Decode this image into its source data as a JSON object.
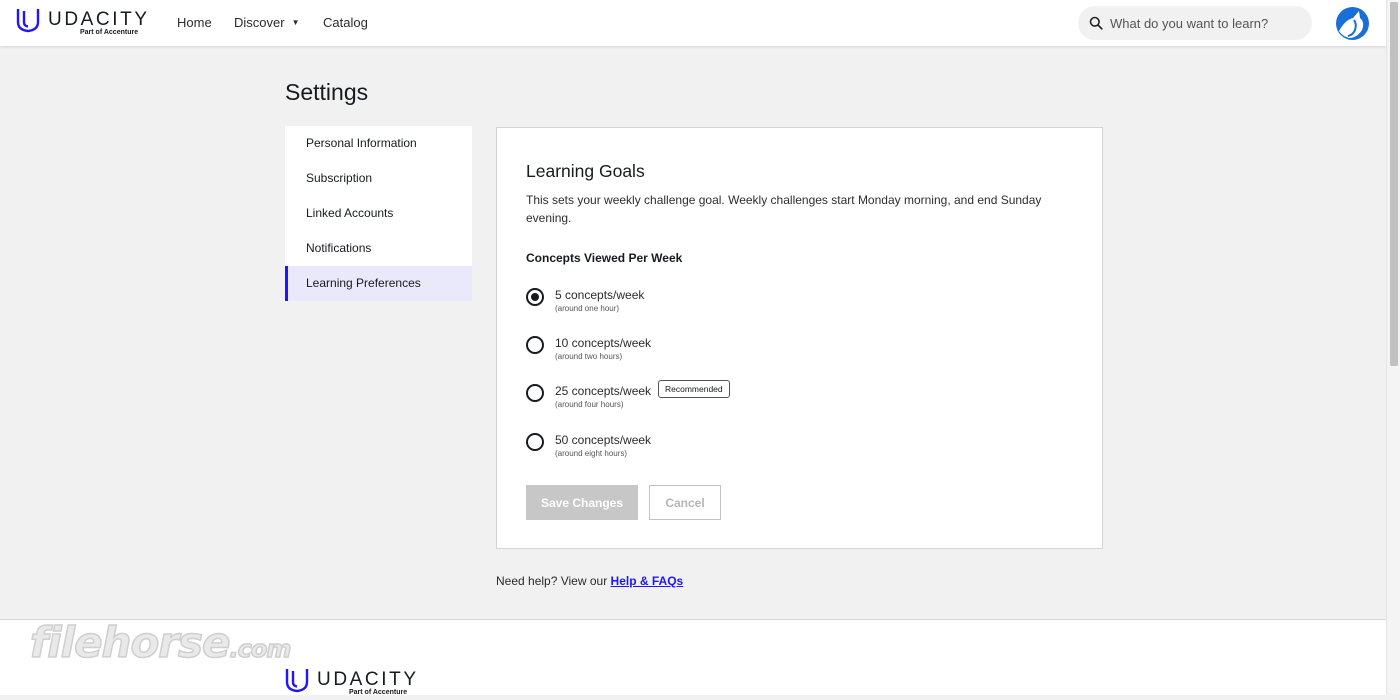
{
  "header": {
    "brand_name": "UDACITY",
    "brand_subtitle": "Part of Accenture",
    "nav": [
      {
        "label": "Home"
      },
      {
        "label": "Discover",
        "has_dropdown": true
      },
      {
        "label": "Catalog"
      }
    ],
    "search": {
      "placeholder": "What do you want to learn?",
      "value": ""
    }
  },
  "page": {
    "title": "Settings"
  },
  "sidebar": {
    "items": [
      {
        "label": "Personal Information",
        "active": false
      },
      {
        "label": "Subscription",
        "active": false
      },
      {
        "label": "Linked Accounts",
        "active": false
      },
      {
        "label": "Notifications",
        "active": false
      },
      {
        "label": "Learning Preferences",
        "active": true
      }
    ]
  },
  "card": {
    "title": "Learning Goals",
    "description": "This sets your weekly challenge goal. Weekly challenges start Monday morning, and end Sunday evening.",
    "group_label": "Concepts Viewed Per Week",
    "options": [
      {
        "label": "5 concepts/week",
        "sub": "(around one hour)",
        "checked": true
      },
      {
        "label": "10 concepts/week",
        "sub": "(around two hours)",
        "checked": false
      },
      {
        "label": "25 concepts/week",
        "sub": "(around four hours)",
        "checked": false,
        "badge": "Recommended"
      },
      {
        "label": "50 concepts/week",
        "sub": "(around eight hours)",
        "checked": false
      }
    ],
    "save_label": "Save Changes",
    "cancel_label": "Cancel"
  },
  "help": {
    "prefix": "Need help? View our",
    "link_label": "Help & FAQs"
  },
  "footer": {
    "brand_name": "UDACITY",
    "brand_subtitle": "Part of Accenture"
  },
  "watermark": {
    "text": "filehorse",
    "suffix": ".com"
  },
  "colors": {
    "accent": "#2015ff",
    "active_bg": "#e9e9fb",
    "page_bg": "#f1f1f1",
    "disabled_button": "#c7c7c7"
  },
  "icons": {
    "brand": "udacity-logo-icon",
    "search": "search-icon",
    "avatar": "avatar-icon",
    "dropdown": "caret-down-icon"
  }
}
